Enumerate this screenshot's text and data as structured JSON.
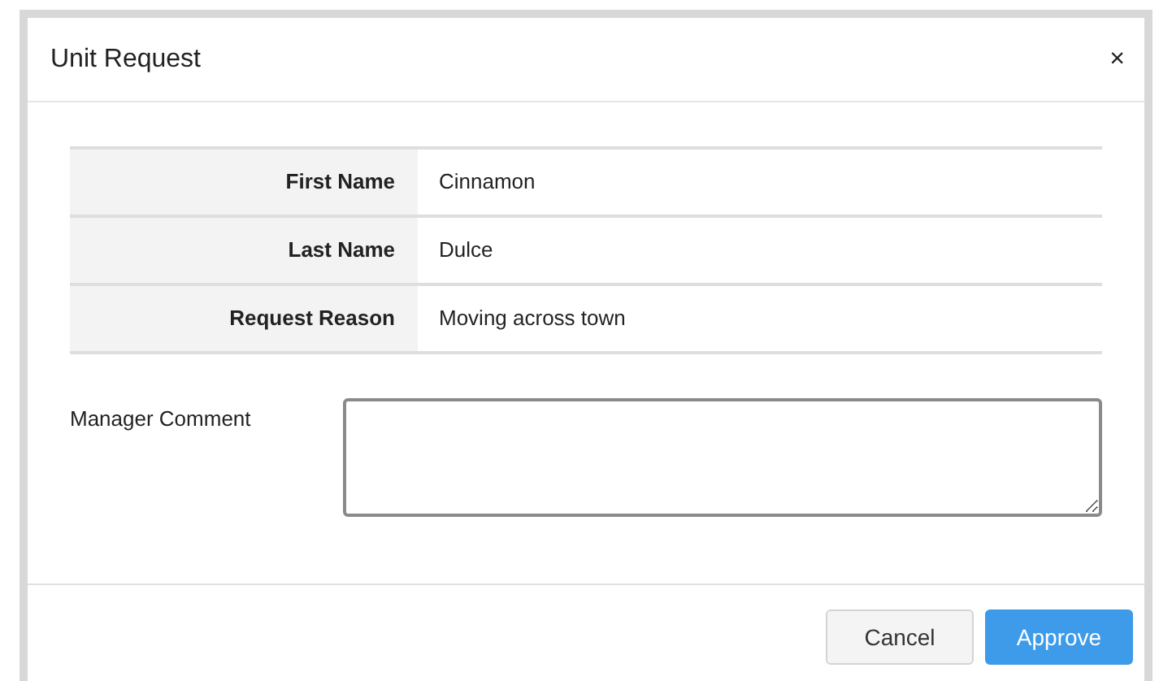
{
  "dialog": {
    "title": "Unit Request",
    "close": "×"
  },
  "details": [
    {
      "label": "First Name",
      "value": "Cinnamon"
    },
    {
      "label": "Last Name",
      "value": "Dulce"
    },
    {
      "label": "Request Reason",
      "value": "Moving across town"
    }
  ],
  "comment": {
    "label": "Manager Comment"
  },
  "buttons": [
    {
      "label": "Cancel",
      "kind": "secondary"
    },
    {
      "label": "Approve",
      "kind": "primary"
    }
  ]
}
